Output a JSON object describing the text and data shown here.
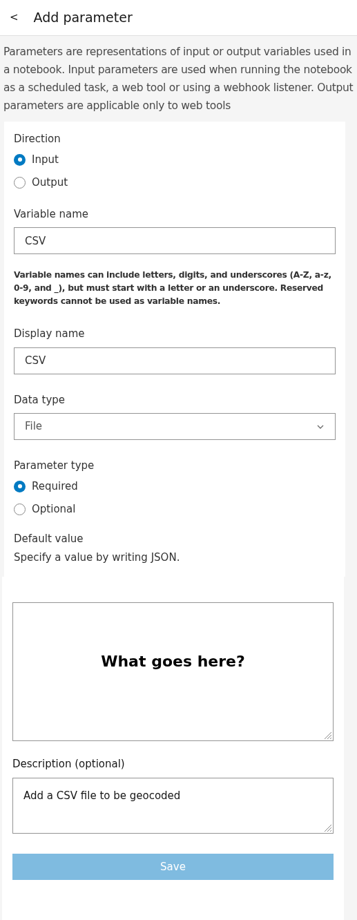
{
  "header": {
    "back": "<",
    "title": "Add parameter"
  },
  "intro": "Parameters are representations of input or output variables used in a notebook. Input parameters are used when running the notebook as a scheduled task, a web tool or using a webhook listener. Output parameters are applicable only to web tools",
  "direction": {
    "label": "Direction",
    "options": [
      {
        "label": "Input",
        "selected": true
      },
      {
        "label": "Output",
        "selected": false
      }
    ]
  },
  "variable_name": {
    "label": "Variable name",
    "value": "CSV",
    "help": "Variable names can include letters, digits, and underscores (A-Z, a-z, 0-9, and _), but must start with a letter or an underscore. Reserved keywords cannot be used as variable names."
  },
  "display_name": {
    "label": "Display name",
    "value": "CSV"
  },
  "data_type": {
    "label": "Data type",
    "value": "File"
  },
  "parameter_type": {
    "label": "Parameter type",
    "options": [
      {
        "label": "Required",
        "selected": true
      },
      {
        "label": "Optional",
        "selected": false
      }
    ]
  },
  "default_value": {
    "label": "Default value",
    "hint": "Specify a value by writing JSON.",
    "value": "What goes here?"
  },
  "description": {
    "label": "Description (optional)",
    "value": "Add a CSV file to be geocoded"
  },
  "save_button": {
    "label": "Save",
    "disabled": true
  }
}
